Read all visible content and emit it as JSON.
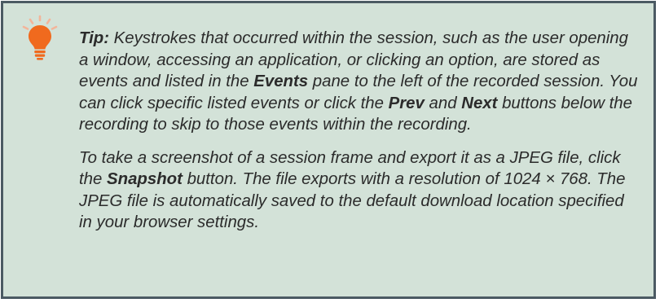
{
  "tip": {
    "icon": "lightbulb-icon",
    "accent_color": "#f06a1e",
    "ray_color": "#f3b59a",
    "background_color": "#d3e2d8",
    "border_color": "#4b5a63",
    "p1": {
      "label": "Tip:",
      "t1": " Keystrokes that occurred within the session, such as the user opening a window, accessing an application, or clicking an option, are stored as events and listed in the ",
      "events": "Events",
      "t2": " pane to the left of the recorded session. You can click specific listed events or click the ",
      "prev": "Prev",
      "t3": " and ",
      "next": "Next",
      "t4": " buttons below the recording to skip to those events within the recording."
    },
    "p2": {
      "t1": "To take a screenshot of a session frame and export it as a JPEG file, click the ",
      "snapshot": "Snapshot",
      "t2": " button. The file exports with a resolution of 1024 × 768. The JPEG file is automatically saved to the default download location specified in your browser settings."
    }
  }
}
